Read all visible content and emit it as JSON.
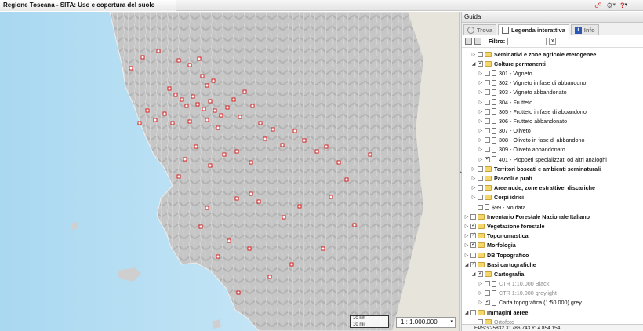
{
  "header": {
    "app_title": "Regione Toscana - SITA: Uso e copertura del suolo",
    "icons": [
      "link-icon",
      "gear-icon",
      "help-icon",
      "italy-flag-icon"
    ],
    "dropdown_mark": "▾"
  },
  "map": {
    "scale_select": "1 : 1.000.000",
    "scalebar": {
      "km": "10 km",
      "mi": "10 mi"
    }
  },
  "panel": {
    "title": "Guida",
    "tabs": [
      {
        "label": "Trova",
        "active": false
      },
      {
        "label": "Legenda interattiva",
        "active": true
      },
      {
        "label": "Info",
        "active": false
      }
    ],
    "filter_label": "Filtro:",
    "filter_value": "",
    "filter_clear": "x"
  },
  "tree": [
    {
      "label": "Seminativi e zone agricole eterogenee",
      "bold": true,
      "indent": 1,
      "type": "folder",
      "checked": false,
      "expander": "▷"
    },
    {
      "label": "Colture permanenti",
      "bold": true,
      "indent": 1,
      "type": "folder",
      "checked": true,
      "expander": "◢"
    },
    {
      "label": "301 - Vigneto",
      "indent": 2,
      "type": "page",
      "checked": false,
      "expander": "▷"
    },
    {
      "label": "302 - Vigneto in fase di abbandono",
      "indent": 2,
      "type": "page",
      "checked": false,
      "expander": "▷"
    },
    {
      "label": "303 - Vigneto abbandonato",
      "indent": 2,
      "type": "page",
      "checked": false,
      "expander": "▷"
    },
    {
      "label": "304 - Frutteto",
      "indent": 2,
      "type": "page",
      "checked": false,
      "expander": "▷"
    },
    {
      "label": "305 - Frutteto in fase di abbandono",
      "indent": 2,
      "type": "page",
      "checked": false,
      "expander": "▷"
    },
    {
      "label": "306 - Frutteto abbandonato",
      "indent": 2,
      "type": "page",
      "checked": false,
      "expander": "▷"
    },
    {
      "label": "307 - Oliveto",
      "indent": 2,
      "type": "page",
      "checked": false,
      "expander": "▷"
    },
    {
      "label": "308 - Oliveto in fase di abbandono",
      "indent": 2,
      "type": "page",
      "checked": false,
      "expander": "▷"
    },
    {
      "label": "309 - Oliveto abbandonato",
      "indent": 2,
      "type": "page",
      "checked": false,
      "expander": "▷"
    },
    {
      "label": "401 - Pioppeti specializzati od altri analoghi",
      "indent": 2,
      "type": "page",
      "checked": true,
      "expander": "▷"
    },
    {
      "label": "Territori boscati e ambienti seminaturali",
      "bold": true,
      "indent": 1,
      "type": "folder",
      "checked": false,
      "expander": "▷"
    },
    {
      "label": "Pascoli e prati",
      "bold": true,
      "indent": 1,
      "type": "folder",
      "checked": false,
      "expander": "▷"
    },
    {
      "label": "Aree nude, zone estrattive, discariche",
      "bold": true,
      "indent": 1,
      "type": "folder",
      "checked": false,
      "expander": "▷"
    },
    {
      "label": "Corpi idrici",
      "bold": true,
      "indent": 1,
      "type": "folder",
      "checked": false,
      "expander": "▷"
    },
    {
      "label": "$99 - No data",
      "indent": 1,
      "type": "page",
      "checked": false,
      "expander": ""
    },
    {
      "label": "Inventario Forestale Nazionale Italiano",
      "bold": true,
      "indent": 0,
      "type": "folder",
      "checked": false,
      "expander": "▷"
    },
    {
      "label": "Vegetazione forestale",
      "bold": true,
      "indent": 0,
      "type": "folder",
      "checked": true,
      "expander": "▷"
    },
    {
      "label": "Toponomastica",
      "bold": true,
      "indent": 0,
      "type": "folder",
      "checked": true,
      "expander": "▷"
    },
    {
      "label": "Morfologia",
      "bold": true,
      "indent": 0,
      "type": "folder",
      "checked": true,
      "expander": "▷"
    },
    {
      "label": "DB Topografico",
      "bold": true,
      "indent": 0,
      "type": "folder",
      "checked": false,
      "expander": "▷"
    },
    {
      "label": "Basi cartografiche",
      "bold": true,
      "indent": 0,
      "type": "folder",
      "checked": true,
      "expander": "◢"
    },
    {
      "label": "Cartografia",
      "bold": true,
      "indent": 1,
      "type": "folder",
      "checked": true,
      "expander": "◢"
    },
    {
      "label": "CTR 1:10.000 Black",
      "indent": 2,
      "type": "page",
      "checked": false,
      "grey": true,
      "expander": "▷"
    },
    {
      "label": "CTR 1:10.000 greylight",
      "indent": 2,
      "type": "page",
      "checked": false,
      "grey": true,
      "expander": "▷"
    },
    {
      "label": "Carta topografica (1:50.000) grey",
      "indent": 2,
      "type": "page",
      "checked": true,
      "expander": "▷"
    },
    {
      "label": "Immagini aeree",
      "bold": true,
      "indent": 0,
      "type": "folder",
      "checked": false,
      "expander": "◢"
    },
    {
      "label": "Ortofoto",
      "indent": 1,
      "type": "folder",
      "checked": false,
      "grey": true,
      "expander": ""
    }
  ],
  "status": "EPSG:25832  X: 786.743  Y: 4.854.154",
  "colors": {
    "sea": "#bfe3f4",
    "land": "#c9c9c9",
    "marker": "#d42020",
    "folder": "#f5d66b"
  }
}
